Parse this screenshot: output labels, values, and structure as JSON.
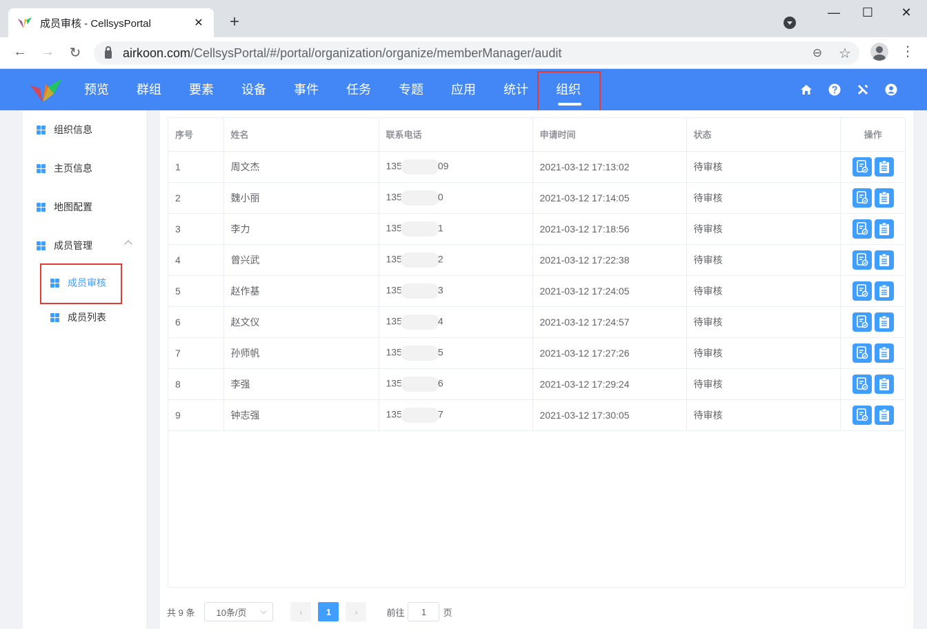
{
  "browser": {
    "tab_title": "成员审核 - CellsysPortal",
    "tab_close": "✕",
    "new_tab": "+",
    "url_domain": "airkoon.com",
    "url_path": "/CellsysPortal/#/portal/organization/organize/memberManager/audit",
    "back": "←",
    "forward": "→",
    "reload": "↻",
    "zoom_icon": "⊖",
    "star_icon": "☆",
    "menu_icon": "⋮",
    "minimize": "—",
    "maximize": "☐",
    "close": "✕"
  },
  "header": {
    "nav": [
      "预览",
      "群组",
      "要素",
      "设备",
      "事件",
      "任务",
      "专题",
      "应用",
      "统计",
      "组织"
    ],
    "active_index": 9
  },
  "sidebar": {
    "items": [
      "组织信息",
      "主页信息",
      "地图配置",
      "成员管理"
    ],
    "subitems": [
      "成员审核",
      "成员列表"
    ],
    "active_sub": 0
  },
  "table": {
    "headers": [
      "序号",
      "姓名",
      "联系电话",
      "申请时间",
      "状态",
      "操作"
    ],
    "rows": [
      {
        "no": "1",
        "name": "周文杰",
        "phone_prefix": "135",
        "phone_suffix": "09",
        "time": "2021-03-12 17:13:02",
        "status": "待审核"
      },
      {
        "no": "2",
        "name": "魏小丽",
        "phone_prefix": "135",
        "phone_suffix": "0",
        "time": "2021-03-12 17:14:05",
        "status": "待审核"
      },
      {
        "no": "3",
        "name": "李力",
        "phone_prefix": "135",
        "phone_suffix": "1",
        "time": "2021-03-12 17:18:56",
        "status": "待审核"
      },
      {
        "no": "4",
        "name": "曾兴武",
        "phone_prefix": "135",
        "phone_suffix": "2",
        "time": "2021-03-12 17:22:38",
        "status": "待审核"
      },
      {
        "no": "5",
        "name": "赵作基",
        "phone_prefix": "135",
        "phone_suffix": "3",
        "time": "2021-03-12 17:24:05",
        "status": "待审核"
      },
      {
        "no": "6",
        "name": "赵文仪",
        "phone_prefix": "135",
        "phone_suffix": "4",
        "time": "2021-03-12 17:24:57",
        "status": "待审核"
      },
      {
        "no": "7",
        "name": "孙师帆",
        "phone_prefix": "135",
        "phone_suffix": "5",
        "time": "2021-03-12 17:27:26",
        "status": "待审核"
      },
      {
        "no": "8",
        "name": "李强",
        "phone_prefix": "135",
        "phone_suffix": "6",
        "time": "2021-03-12 17:29:24",
        "status": "待审核"
      },
      {
        "no": "9",
        "name": "钟志强",
        "phone_prefix": "135",
        "phone_suffix": "7",
        "time": "2021-03-12 17:30:05",
        "status": "待审核"
      }
    ]
  },
  "pagination": {
    "total": "共 9 条",
    "page_size": "10条/页",
    "prev": "‹",
    "next": "›",
    "current": "1",
    "goto_label": "前往",
    "goto_value": "1",
    "page_suffix": "页"
  },
  "colors": {
    "header_bg": "#4287f5",
    "accent": "#409eff",
    "highlight": "#e53935"
  }
}
